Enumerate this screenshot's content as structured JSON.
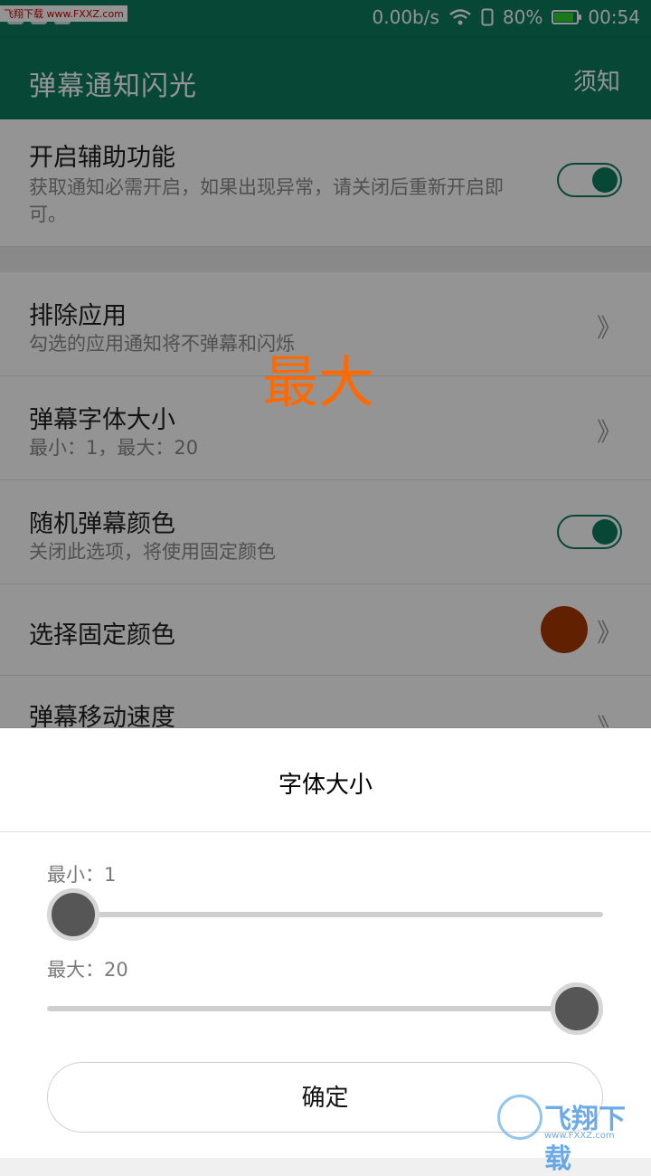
{
  "status_bar": {
    "watermark": "飞翔下载 www.FXXZ.com",
    "network_speed": "0.00b/s",
    "battery_percent": "80%",
    "time": "00:54",
    "icons": [
      "notification-icon",
      "sim-icon",
      "usb-icon",
      "wifi-icon",
      "sim-card-icon",
      "battery-icon"
    ]
  },
  "toolbar": {
    "title": "弹幕通知闪光",
    "action": "须知"
  },
  "settings": {
    "accessibility": {
      "title": "开启辅助功能",
      "subtitle": "获取通知必需开启，如果出现异常，请关闭后重新开启即可。",
      "enabled": true
    },
    "exclude_apps": {
      "title": "排除应用",
      "subtitle": "勾选的应用通知将不弹幕和闪烁"
    },
    "font_size": {
      "title": "弹幕字体大小",
      "subtitle": "最小：1，最大：20"
    },
    "random_color": {
      "title": "随机弹幕颜色",
      "subtitle": "关闭此选项，将使用固定颜色",
      "enabled": true
    },
    "fixed_color": {
      "title": "选择固定颜色",
      "color": "#a83a00"
    },
    "speed": {
      "title": "弹幕移动速度"
    },
    "chevron": "》"
  },
  "preview_text": "最大",
  "dialog": {
    "title": "字体大小",
    "min_label": "最小：1",
    "max_label": "最大：20",
    "min_value_fraction": 0,
    "max_value_fraction": 1,
    "confirm": "确定"
  },
  "watermark_logo": {
    "text": "飞翔下载",
    "url": "www.FXXZ.com"
  },
  "colors": {
    "primary": "#0b7a5c",
    "preview_orange": "#ff6a00"
  }
}
